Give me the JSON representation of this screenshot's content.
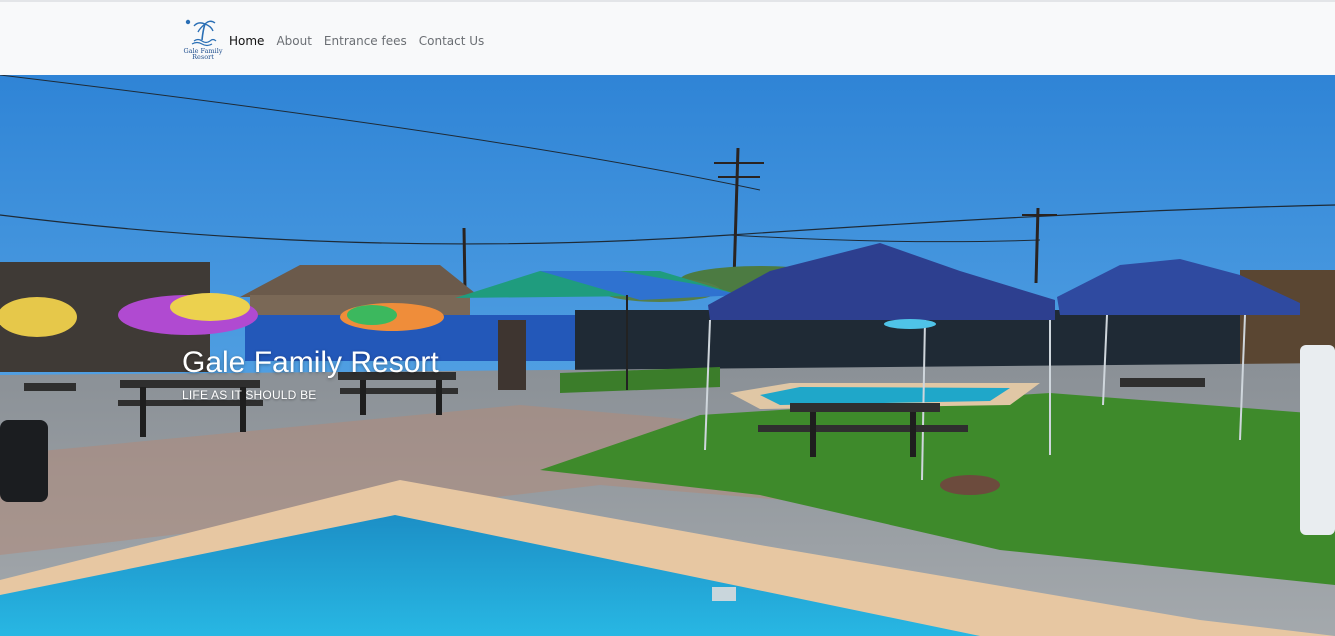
{
  "brand": {
    "logo_text_line1": "Gale Family",
    "logo_text_line2": "Resort",
    "logo_icon": "palm-tree-icon"
  },
  "nav": {
    "items": [
      {
        "label": "Home",
        "active": true
      },
      {
        "label": "About",
        "active": false
      },
      {
        "label": "Entrance fees",
        "active": false
      },
      {
        "label": "Contact Us",
        "active": false
      }
    ]
  },
  "hero": {
    "title": "Gale Family Resort",
    "subtitle": "LIFE AS IT SHOULD BE"
  },
  "colors": {
    "navbar_bg": "#f8f9fa",
    "nav_active": "#111111",
    "nav_muted": "#6b6f74",
    "sky": "#3a8fd8",
    "pool": "#1aa3d4",
    "gazebo": "#2d3f8f"
  }
}
